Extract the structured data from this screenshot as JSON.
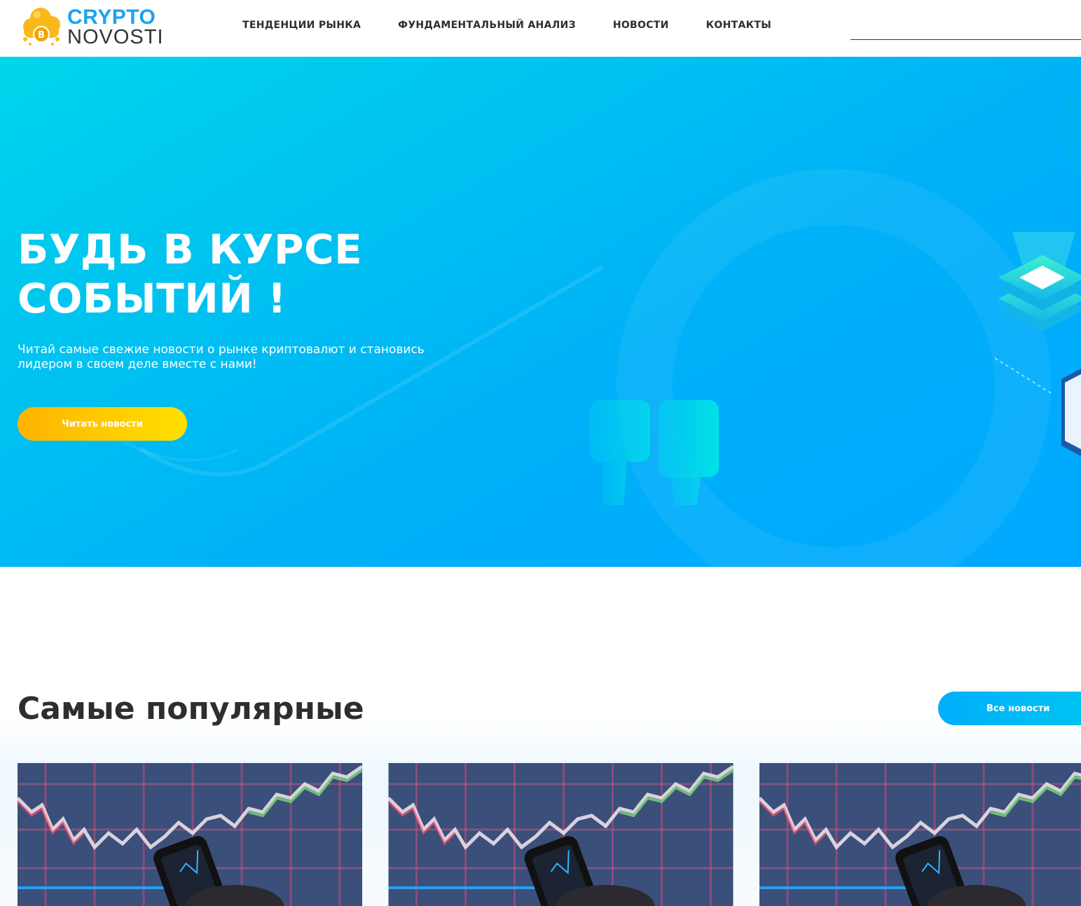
{
  "brand": {
    "line1": "CRYPTO",
    "line2": "NOVOSTI",
    "logo_icon": "bitcoin-cloud-icon",
    "colors": {
      "blue": "#1aa3f0",
      "gold": "#f9b91a"
    }
  },
  "nav": {
    "items": [
      {
        "label": "ТЕНДЕНЦИИ РЫНКА"
      },
      {
        "label": "ФУНДАМЕНТАЛЬНЫЙ АНАЛИЗ"
      },
      {
        "label": "НОВОСТИ"
      },
      {
        "label": "КОНТАКТЫ"
      }
    ]
  },
  "hero": {
    "title_line1": "БУДЬ В КУРСЕ",
    "title_line2": "СОБЫТИЙ !",
    "subtitle_line1": "Читай самые свежие новости о рынке криптовалют и становись",
    "subtitle_line2": "лидером в своем деле вместе с нами!",
    "cta_label": "Читать новости",
    "colors": {
      "bg_start": "#00d6ec",
      "bg_end": "#00a8ff",
      "cta_start": "#ffb300",
      "cta_end": "#ffe000"
    }
  },
  "popular": {
    "title": "Самые популярные",
    "all_news_label": "Все новости",
    "cards": [
      {
        "image": "trading-chart-phone-photo"
      },
      {
        "image": "trading-chart-phone-photo"
      },
      {
        "image": "trading-chart-phone-photo"
      }
    ]
  }
}
